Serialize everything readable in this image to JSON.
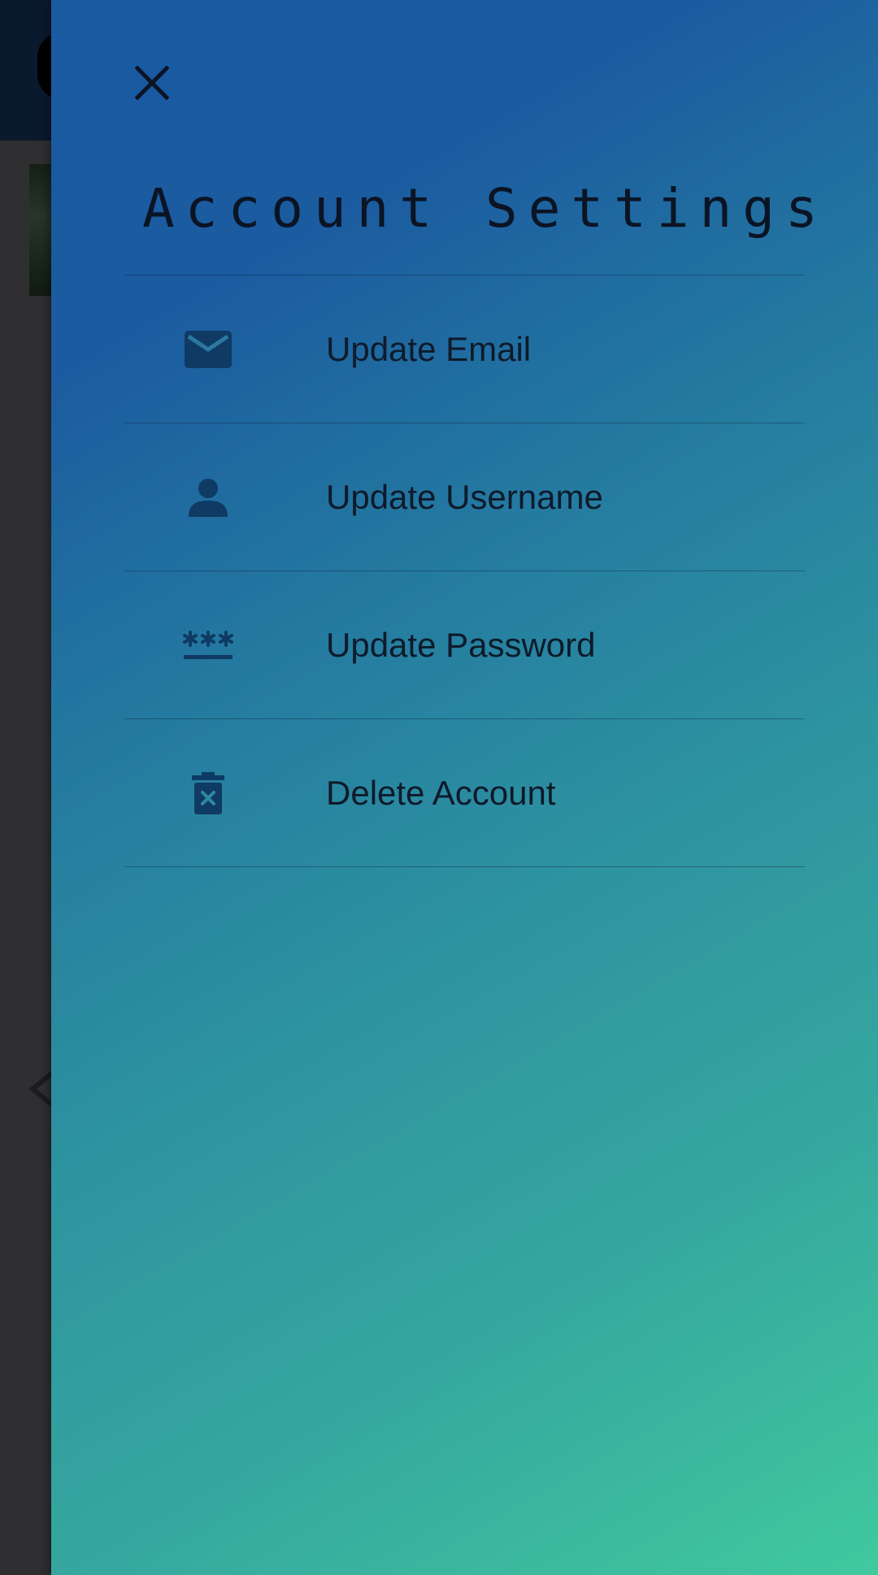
{
  "drawer": {
    "title": "Account Settings",
    "close_icon": "close-icon",
    "items": [
      {
        "label": "Update Email",
        "icon": "email-icon"
      },
      {
        "label": "Update Username",
        "icon": "person-icon"
      },
      {
        "label": "Update Password",
        "icon": "password-icon"
      },
      {
        "label": "Delete Account",
        "icon": "delete-icon"
      }
    ]
  },
  "colors": {
    "gradient_start": "#1a5aa0",
    "gradient_end": "#40c99e",
    "icon": "#0f3a63",
    "text": "#0e1a2a",
    "scrim": "#2f2f31"
  }
}
